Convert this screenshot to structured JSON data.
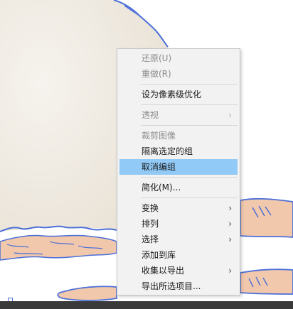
{
  "colors": {
    "illustration_outline": "#4c6fd8",
    "balloon_fill": "#efeae2",
    "skin_fill": "#f1c8ac",
    "menu_background": "#f2f2f2",
    "menu_highlight": "#91c9f7",
    "disabled_text": "#8d8d8d"
  },
  "context_menu": {
    "items": [
      {
        "label": "还原(U)",
        "state": "disabled"
      },
      {
        "label": "重做(R)",
        "state": "disabled"
      },
      {
        "separator": true
      },
      {
        "label": "设为像素级优化",
        "state": "enabled"
      },
      {
        "separator": true
      },
      {
        "label": "透视",
        "state": "disabled",
        "submenu": true
      },
      {
        "separator": true
      },
      {
        "label": "裁剪图像",
        "state": "disabled"
      },
      {
        "label": "隔离选定的组",
        "state": "enabled"
      },
      {
        "label": "取消编组",
        "state": "highlighted"
      },
      {
        "separator": true
      },
      {
        "label": "简化(M)...",
        "state": "enabled"
      },
      {
        "separator": true
      },
      {
        "label": "变换",
        "state": "enabled",
        "submenu": true
      },
      {
        "label": "排列",
        "state": "enabled",
        "submenu": true
      },
      {
        "label": "选择",
        "state": "enabled",
        "submenu": true
      },
      {
        "label": "添加到库",
        "state": "enabled"
      },
      {
        "label": "收集以导出",
        "state": "enabled",
        "submenu": true
      },
      {
        "label": "导出所选项目...",
        "state": "enabled"
      }
    ],
    "submenu_arrow_glyph": "›"
  }
}
